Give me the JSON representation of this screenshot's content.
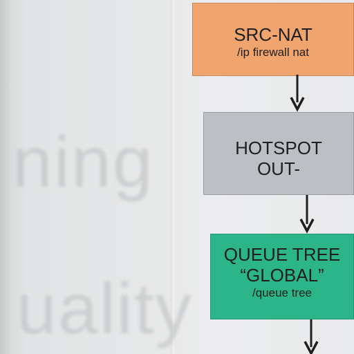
{
  "background": {
    "ghost_text_1": "ning",
    "ghost_text_2": "uality"
  },
  "diagram": {
    "boxes": [
      {
        "id": "srcnat",
        "title": "SRC-NAT",
        "subtitle": "/ip firewall nat",
        "color": "#f0a46e"
      },
      {
        "id": "hotspot",
        "title_line1": "HOTSPOT",
        "title_line2": "OUT-",
        "color": "#bcc0c4"
      },
      {
        "id": "queue",
        "title_line1": "QUEUE TREE",
        "title_line2": "“GLOBAL”",
        "subtitle": "/queue tree",
        "color": "#2bb589"
      }
    ],
    "arrow_color": "#1e1e1e"
  }
}
